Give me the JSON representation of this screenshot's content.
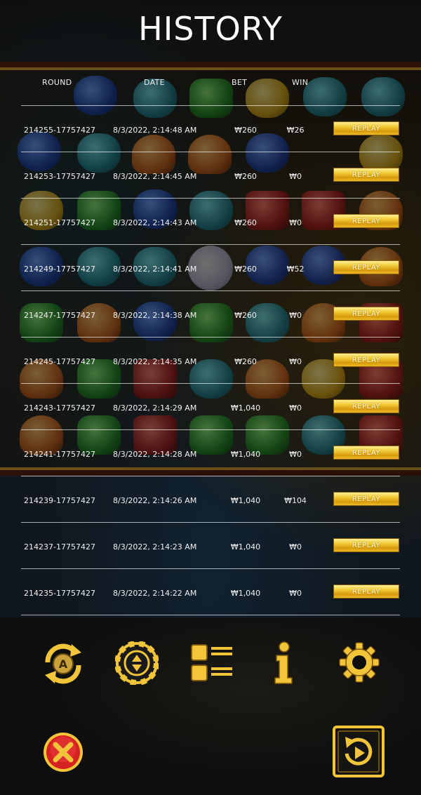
{
  "header": {
    "title": "HISTORY"
  },
  "table": {
    "columns": {
      "round": "ROUND",
      "date": "DATE",
      "bet": "BET",
      "win": "WIN"
    },
    "rows": [
      {
        "round": "214255-17757427",
        "date": "8/3/2022, 2:14:48 AM",
        "bet": "₩260",
        "win": "₩26",
        "replay": "REPLAY"
      },
      {
        "round": "214253-17757427",
        "date": "8/3/2022, 2:14:45 AM",
        "bet": "₩260",
        "win": "₩0",
        "replay": "REPLAY"
      },
      {
        "round": "214251-17757427",
        "date": "8/3/2022, 2:14:43 AM",
        "bet": "₩260",
        "win": "₩0",
        "replay": "REPLAY"
      },
      {
        "round": "214249-17757427",
        "date": "8/3/2022, 2:14:41 AM",
        "bet": "₩260",
        "win": "₩52",
        "replay": "REPLAY"
      },
      {
        "round": "214247-17757427",
        "date": "8/3/2022, 2:14:38 AM",
        "bet": "₩260",
        "win": "₩0",
        "replay": "REPLAY"
      },
      {
        "round": "214245-17757427",
        "date": "8/3/2022, 2:14:35 AM",
        "bet": "₩260",
        "win": "₩0",
        "replay": "REPLAY"
      },
      {
        "round": "214243-17757427",
        "date": "8/3/2022, 2:14:29 AM",
        "bet": "₩1,040",
        "win": "₩0",
        "replay": "REPLAY"
      },
      {
        "round": "214241-17757427",
        "date": "8/3/2022, 2:14:28 AM",
        "bet": "₩1,040",
        "win": "₩0",
        "replay": "REPLAY"
      },
      {
        "round": "214239-17757427",
        "date": "8/3/2022, 2:14:26 AM",
        "bet": "₩1,040",
        "win": "₩104",
        "replay": "REPLAY"
      },
      {
        "round": "214237-17757427",
        "date": "8/3/2022, 2:14:23 AM",
        "bet": "₩1,040",
        "win": "₩0",
        "replay": "REPLAY"
      },
      {
        "round": "214235-17757427",
        "date": "8/3/2022, 2:14:22 AM",
        "bet": "₩1,040",
        "win": "₩0",
        "replay": "REPLAY"
      }
    ]
  },
  "toolbar": {
    "icons": [
      "autoplay-icon",
      "bet-chip-icon",
      "history-list-icon",
      "info-icon",
      "settings-gear-icon"
    ]
  },
  "footer": {
    "close_icon": "close-icon",
    "replay_icon": "replay-play-icon"
  },
  "colors": {
    "gold": "#f4cf3c",
    "gold_dark": "#b07c0a",
    "close_red": "#d62222",
    "divider": "#ffffff"
  }
}
